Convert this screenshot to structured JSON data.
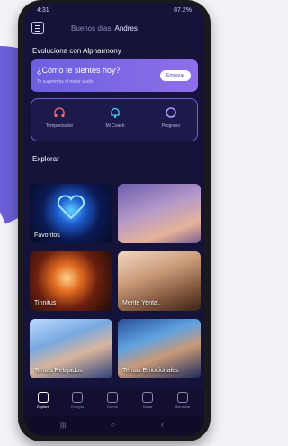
{
  "status": {
    "time": "4:31",
    "right": "87.2%"
  },
  "header": {
    "greeting": "Buenos días,",
    "name": "Andres"
  },
  "section1": {
    "title": "Evoluciona con Alpharmony"
  },
  "promo": {
    "question": "¿Cómo te sientes hoy?",
    "subtitle": "Te sugerimos el mejor audio",
    "button": "Empezar"
  },
  "features": [
    {
      "label": "Temporizador",
      "icon": "headphones-icon"
    },
    {
      "label": "Mi Coach",
      "icon": "bell-icon"
    },
    {
      "label": "Progreso",
      "icon": "ring-icon"
    }
  ],
  "explore": {
    "title": "Explorar"
  },
  "cards": [
    {
      "label": "Favoritos"
    },
    {
      "label": ""
    },
    {
      "label": "Tinnitus"
    },
    {
      "label": "Mente Yenta.."
    },
    {
      "label": "Temas Relajados"
    },
    {
      "label": "Temas Emocionales"
    }
  ],
  "nav": [
    {
      "label": "Explora",
      "active": true
    },
    {
      "label": "Energía",
      "active": false
    },
    {
      "label": "Dormir",
      "active": false
    },
    {
      "label": "Sanar",
      "active": false
    },
    {
      "label": "Bienestar",
      "active": false
    }
  ],
  "sysnav": {
    "recents": "|||",
    "home": "○",
    "back": "‹"
  },
  "colors": {
    "bg": "#15133a",
    "accent": "#6c5fe0"
  }
}
